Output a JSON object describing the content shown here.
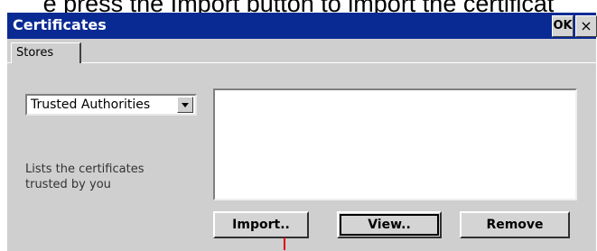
{
  "caption": "e press the Import button to import the certificat",
  "window": {
    "title": "Certificates",
    "ok_label": "OK",
    "close_label": "×"
  },
  "tabs": [
    {
      "label": "Stores",
      "selected": true
    }
  ],
  "store_select": {
    "value": "Trusted Authorities"
  },
  "description": "Lists the certificates trusted by you",
  "buttons": {
    "import": "Import..",
    "view": "View..",
    "remove": "Remove"
  },
  "colors": {
    "titlebar": "#0a2a93",
    "face": "#cfcfcf",
    "cursor": "#dd0000"
  }
}
